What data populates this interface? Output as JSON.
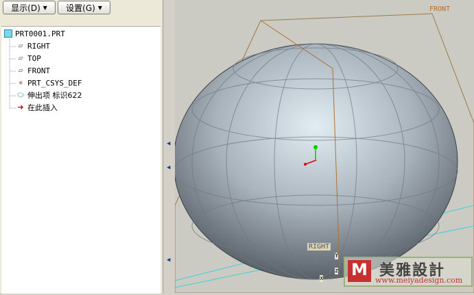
{
  "toolbar": {
    "show_label": "显示(D)",
    "settings_label": "设置(G)"
  },
  "tree": {
    "root": "PRT0001.PRT",
    "items": [
      {
        "label": "RIGHT",
        "icon": "datum-plane-icon"
      },
      {
        "label": "TOP",
        "icon": "datum-plane-icon"
      },
      {
        "label": "FRONT",
        "icon": "datum-plane-icon"
      },
      {
        "label": "PRT_CSYS_DEF",
        "icon": "csys-icon"
      },
      {
        "label": "伸出项 标识622",
        "icon": "protrusion-icon"
      },
      {
        "label": "在此插入",
        "icon": "insert-here-arrow-icon"
      }
    ]
  },
  "viewport": {
    "front_label": "FRONT",
    "right_label": "RIGHT",
    "axis_x": "x",
    "axis_y": "Y",
    "axis_z": "z"
  },
  "watermark": {
    "brand": "美雅設計",
    "url": "www.meiyadesign.com"
  }
}
